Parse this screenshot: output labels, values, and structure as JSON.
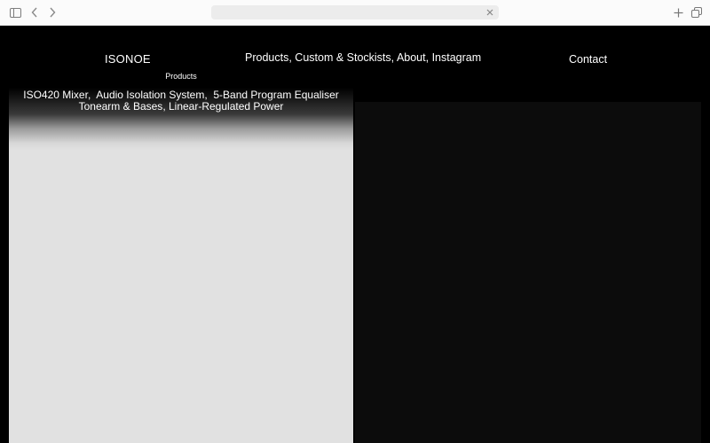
{
  "browser": {
    "address_value": "",
    "icons": [
      "sidebar-icon",
      "back-icon",
      "forward-icon",
      "clear-icon",
      "plus-icon",
      "tabs-icon"
    ]
  },
  "header": {
    "brand": "ISONOE",
    "nav": [
      {
        "label": "Products",
        "sep": ", "
      },
      {
        "label": "Custom & Stockists",
        "sep": ", "
      },
      {
        "label": "About",
        "sep": ", "
      },
      {
        "label": "Instagram",
        "sep": ""
      }
    ],
    "contact": "Contact"
  },
  "products_menu": {
    "title": "Products",
    "line1": [
      {
        "label": "ISO420 Mixer",
        "sep": ",  "
      },
      {
        "label": "Audio Isolation System",
        "sep": ",  "
      },
      {
        "label": "5-Band Program Equaliser",
        "sep": ""
      }
    ],
    "line2": [
      {
        "label": "Tonearm & Bases",
        "sep": ", "
      },
      {
        "label": "Linear-Regulated Power",
        "sep": ""
      }
    ]
  },
  "colors": {
    "background": "#000000",
    "panel_light": "#e1e1e1",
    "right_area": "#0c0c0c",
    "text": "#ffffff"
  }
}
